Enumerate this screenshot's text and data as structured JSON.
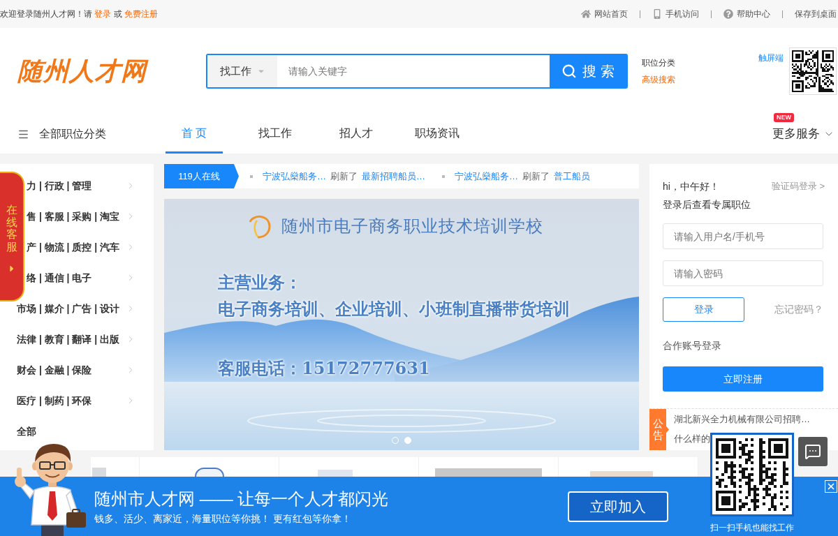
{
  "top_bar": {
    "welcome": "欢迎登录随州人才网！请",
    "login": "登录",
    "or": "或",
    "register": "免费注册",
    "links": [
      {
        "kind": "home",
        "label": "网站首页"
      },
      {
        "kind": "phone",
        "label": "手机访问"
      },
      {
        "kind": "help",
        "label": "帮助中心"
      },
      {
        "kind": "plain",
        "label": "保存到桌面"
      }
    ]
  },
  "header": {
    "logo": "随州人才网",
    "search": {
      "type": "找工作",
      "placeholder": "请输入关键字",
      "button": "搜 索"
    },
    "links": [
      {
        "kind": "plain",
        "label": "职位分类"
      },
      {
        "kind": "highlight",
        "label": "高级搜索"
      }
    ],
    "touch_label": "触屏端"
  },
  "nav": {
    "all_categories": "全部职位分类",
    "items": [
      {
        "label": "首 页",
        "selected": true
      },
      {
        "label": "找工作",
        "selected": false
      },
      {
        "label": "招人才",
        "selected": false
      },
      {
        "label": "职场资讯",
        "selected": false
      }
    ],
    "more": {
      "label": "更多服务",
      "badge": "NEW"
    }
  },
  "online_service": {
    "label": "在线客服"
  },
  "categories": [
    {
      "kind": "category",
      "label": "力 | 行政 | 管理",
      "covered": true
    },
    {
      "kind": "category",
      "label": "售 | 客服 | 采购 | 淘宝",
      "covered": true
    },
    {
      "kind": "category",
      "label": "产 | 物流 | 质控 | 汽车",
      "covered": true
    },
    {
      "kind": "category",
      "label": "络 | 通信 | 电子",
      "covered": true
    },
    {
      "kind": "category",
      "label": "市场 | 媒介 | 广告 | 设计",
      "covered": false
    },
    {
      "kind": "category",
      "label": "法律 | 教育 | 翻译 | 出版",
      "covered": false
    },
    {
      "kind": "category",
      "label": "财会 | 金融 | 保险",
      "covered": false
    },
    {
      "kind": "category",
      "label": "医疗 | 制药 | 环保",
      "covered": false
    },
    {
      "kind": "all",
      "label": "全部",
      "covered": false
    }
  ],
  "ticker": {
    "online": "119人在线",
    "items": [
      {
        "company": "宁波弘燊船务…",
        "action": "刷新了",
        "job": "最新招聘船员…"
      },
      {
        "company": "宁波弘燊船务…",
        "action": "刷新了",
        "job": "普工船员"
      }
    ]
  },
  "banner": {
    "school": "随州市电子商务职业技术培训学校",
    "heading": "主营业务：",
    "services": "电子商务培训、企业培训、小班制直播带货培训",
    "phone": "客服电话：15172777631",
    "dots": [
      {
        "selected": false
      },
      {
        "selected": true
      }
    ]
  },
  "login_panel": {
    "greeting": "hi，中午好！",
    "code_login": "验证码登录 >",
    "subtitle": "登录后查看专属职位",
    "username_placeholder": "请输入用户名/手机号",
    "password_placeholder": "请输入密码",
    "login_button": "登录",
    "forgot": "忘记密码？",
    "partner_login": "合作账号登录",
    "register_button": "立即注册"
  },
  "notice": {
    "tag": "公告",
    "items": [
      "湖北新兴全力机械有限公司招聘…",
      "什么样的"
    ]
  },
  "promo_bar": {
    "slogan": "随州市人才网 —— 让每一个人才都闪光",
    "subtitle": "钱多、活少、离家近，海量职位等你挑！ 更有红包等你拿！",
    "button": "立即加入",
    "qr_caption": "扫一扫手机也能找工作"
  }
}
